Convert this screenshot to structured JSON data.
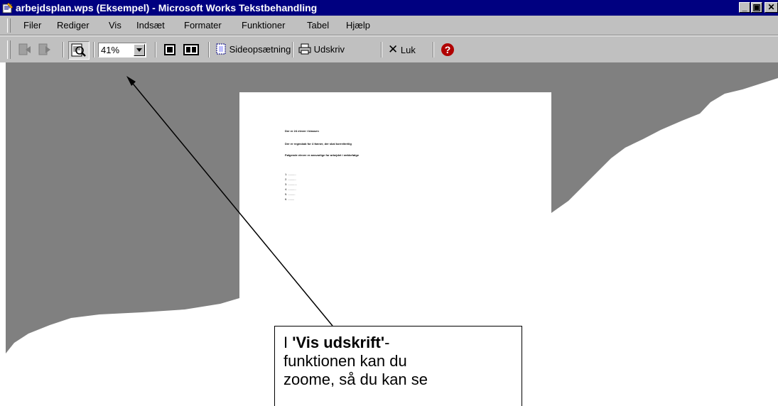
{
  "window": {
    "title": "arbejdsplan.wps (Eksempel) - Microsoft Works Tekstbehandling"
  },
  "menu": [
    "Filer",
    "Rediger",
    "Vis",
    "Indsæt",
    "Formater",
    "Funktioner",
    "Tabel",
    "Hjælp"
  ],
  "toolbar": {
    "zoom_value": "41%",
    "page_setup_label": "Sideopsætning",
    "print_label": "Udskriv",
    "close_label": "Luk"
  },
  "page": {
    "lines": [
      "Der er 24 elever i klassen",
      "Der er regnskab for 4 fanner, der skal korreiteriiig",
      "Følgende elever er ansvarlige for arbejdet i rækkefølge"
    ],
    "list": [
      "1.  ..........",
      "2.  ..........",
      "3.  ...........",
      "4.  ..........",
      "5.  .........",
      "6.  ........"
    ]
  },
  "callout": {
    "prefix": "I ",
    "bold": "'Vis udskrift'",
    "suffix": "-",
    "rest_lines": [
      "funktionen kan du",
      "zoome, så du kan se"
    ]
  },
  "colors": {
    "titlebar": "#000080",
    "chrome": "#c0c0c0",
    "backdrop": "#808080",
    "help": "#b00000"
  }
}
